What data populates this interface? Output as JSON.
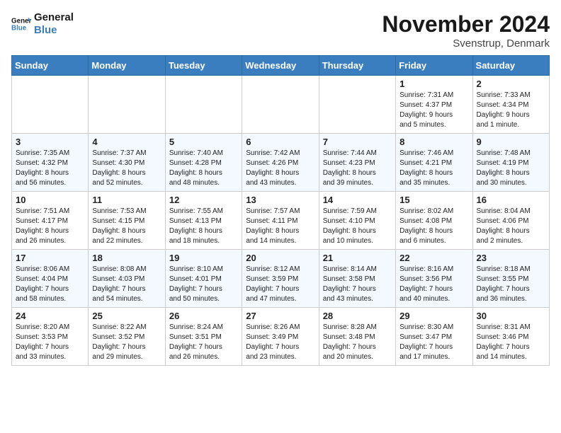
{
  "header": {
    "logo_line1": "General",
    "logo_line2": "Blue",
    "month": "November 2024",
    "location": "Svenstrup, Denmark"
  },
  "weekdays": [
    "Sunday",
    "Monday",
    "Tuesday",
    "Wednesday",
    "Thursday",
    "Friday",
    "Saturday"
  ],
  "weeks": [
    [
      {
        "day": "",
        "info": ""
      },
      {
        "day": "",
        "info": ""
      },
      {
        "day": "",
        "info": ""
      },
      {
        "day": "",
        "info": ""
      },
      {
        "day": "",
        "info": ""
      },
      {
        "day": "1",
        "info": "Sunrise: 7:31 AM\nSunset: 4:37 PM\nDaylight: 9 hours\nand 5 minutes."
      },
      {
        "day": "2",
        "info": "Sunrise: 7:33 AM\nSunset: 4:34 PM\nDaylight: 9 hours\nand 1 minute."
      }
    ],
    [
      {
        "day": "3",
        "info": "Sunrise: 7:35 AM\nSunset: 4:32 PM\nDaylight: 8 hours\nand 56 minutes."
      },
      {
        "day": "4",
        "info": "Sunrise: 7:37 AM\nSunset: 4:30 PM\nDaylight: 8 hours\nand 52 minutes."
      },
      {
        "day": "5",
        "info": "Sunrise: 7:40 AM\nSunset: 4:28 PM\nDaylight: 8 hours\nand 48 minutes."
      },
      {
        "day": "6",
        "info": "Sunrise: 7:42 AM\nSunset: 4:26 PM\nDaylight: 8 hours\nand 43 minutes."
      },
      {
        "day": "7",
        "info": "Sunrise: 7:44 AM\nSunset: 4:23 PM\nDaylight: 8 hours\nand 39 minutes."
      },
      {
        "day": "8",
        "info": "Sunrise: 7:46 AM\nSunset: 4:21 PM\nDaylight: 8 hours\nand 35 minutes."
      },
      {
        "day": "9",
        "info": "Sunrise: 7:48 AM\nSunset: 4:19 PM\nDaylight: 8 hours\nand 30 minutes."
      }
    ],
    [
      {
        "day": "10",
        "info": "Sunrise: 7:51 AM\nSunset: 4:17 PM\nDaylight: 8 hours\nand 26 minutes."
      },
      {
        "day": "11",
        "info": "Sunrise: 7:53 AM\nSunset: 4:15 PM\nDaylight: 8 hours\nand 22 minutes."
      },
      {
        "day": "12",
        "info": "Sunrise: 7:55 AM\nSunset: 4:13 PM\nDaylight: 8 hours\nand 18 minutes."
      },
      {
        "day": "13",
        "info": "Sunrise: 7:57 AM\nSunset: 4:11 PM\nDaylight: 8 hours\nand 14 minutes."
      },
      {
        "day": "14",
        "info": "Sunrise: 7:59 AM\nSunset: 4:10 PM\nDaylight: 8 hours\nand 10 minutes."
      },
      {
        "day": "15",
        "info": "Sunrise: 8:02 AM\nSunset: 4:08 PM\nDaylight: 8 hours\nand 6 minutes."
      },
      {
        "day": "16",
        "info": "Sunrise: 8:04 AM\nSunset: 4:06 PM\nDaylight: 8 hours\nand 2 minutes."
      }
    ],
    [
      {
        "day": "17",
        "info": "Sunrise: 8:06 AM\nSunset: 4:04 PM\nDaylight: 7 hours\nand 58 minutes."
      },
      {
        "day": "18",
        "info": "Sunrise: 8:08 AM\nSunset: 4:03 PM\nDaylight: 7 hours\nand 54 minutes."
      },
      {
        "day": "19",
        "info": "Sunrise: 8:10 AM\nSunset: 4:01 PM\nDaylight: 7 hours\nand 50 minutes."
      },
      {
        "day": "20",
        "info": "Sunrise: 8:12 AM\nSunset: 3:59 PM\nDaylight: 7 hours\nand 47 minutes."
      },
      {
        "day": "21",
        "info": "Sunrise: 8:14 AM\nSunset: 3:58 PM\nDaylight: 7 hours\nand 43 minutes."
      },
      {
        "day": "22",
        "info": "Sunrise: 8:16 AM\nSunset: 3:56 PM\nDaylight: 7 hours\nand 40 minutes."
      },
      {
        "day": "23",
        "info": "Sunrise: 8:18 AM\nSunset: 3:55 PM\nDaylight: 7 hours\nand 36 minutes."
      }
    ],
    [
      {
        "day": "24",
        "info": "Sunrise: 8:20 AM\nSunset: 3:53 PM\nDaylight: 7 hours\nand 33 minutes."
      },
      {
        "day": "25",
        "info": "Sunrise: 8:22 AM\nSunset: 3:52 PM\nDaylight: 7 hours\nand 29 minutes."
      },
      {
        "day": "26",
        "info": "Sunrise: 8:24 AM\nSunset: 3:51 PM\nDaylight: 7 hours\nand 26 minutes."
      },
      {
        "day": "27",
        "info": "Sunrise: 8:26 AM\nSunset: 3:49 PM\nDaylight: 7 hours\nand 23 minutes."
      },
      {
        "day": "28",
        "info": "Sunrise: 8:28 AM\nSunset: 3:48 PM\nDaylight: 7 hours\nand 20 minutes."
      },
      {
        "day": "29",
        "info": "Sunrise: 8:30 AM\nSunset: 3:47 PM\nDaylight: 7 hours\nand 17 minutes."
      },
      {
        "day": "30",
        "info": "Sunrise: 8:31 AM\nSunset: 3:46 PM\nDaylight: 7 hours\nand 14 minutes."
      }
    ]
  ]
}
